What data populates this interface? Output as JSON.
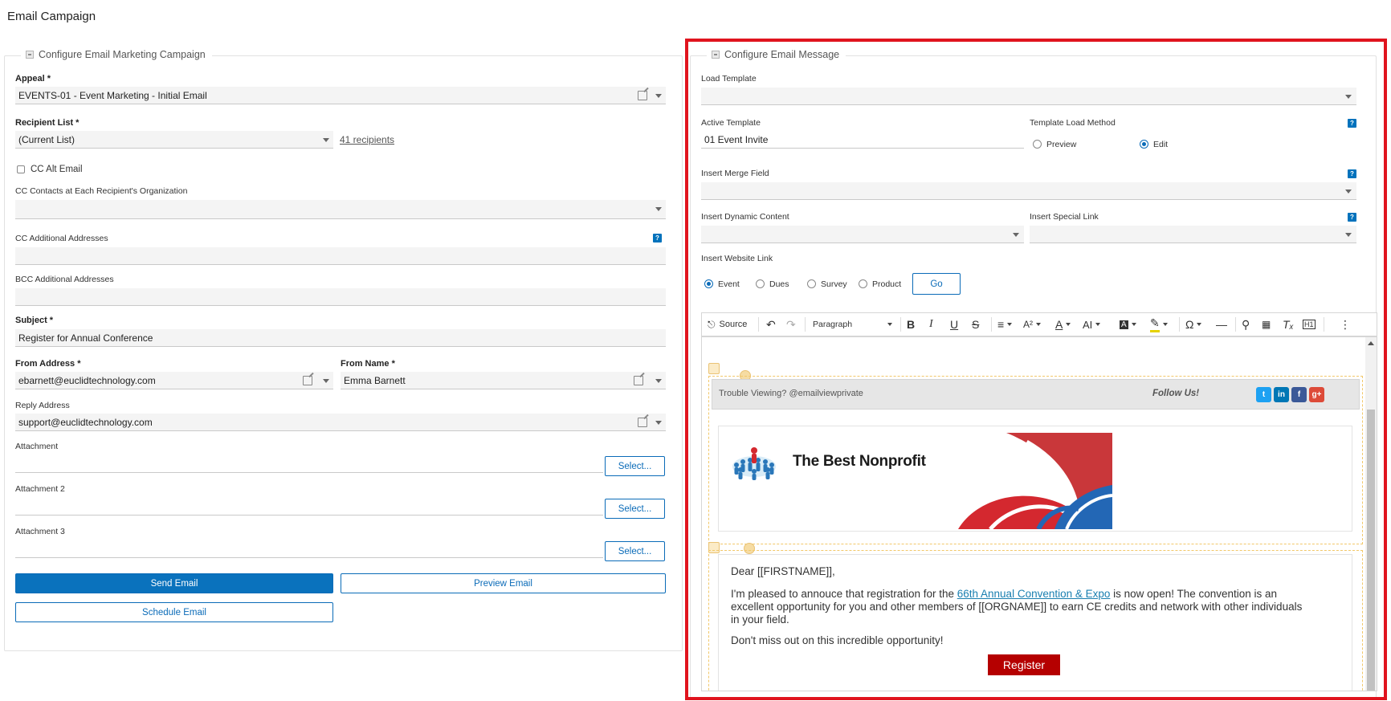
{
  "page_title": "Email Campaign",
  "left_panel": {
    "legend": "Configure Email Marketing Campaign",
    "appeal": {
      "label": "Appeal *",
      "value": "EVENTS-01 - Event Marketing - Initial Email"
    },
    "recipient_list": {
      "label": "Recipient List *",
      "value": "(Current List)",
      "link": "41 recipients"
    },
    "cc_alt_email": {
      "label": "CC Alt Email"
    },
    "cc_contacts": {
      "label": "CC Contacts at Each Recipient's Organization",
      "value": ""
    },
    "cc_additional": {
      "label": "CC Additional Addresses",
      "value": ""
    },
    "bcc_additional": {
      "label": "BCC Additional Addresses",
      "value": ""
    },
    "subject": {
      "label": "Subject *",
      "value": "Register for Annual Conference"
    },
    "from_address": {
      "label": "From Address *",
      "value": "ebarnett@euclidtechnology.com"
    },
    "from_name": {
      "label": "From Name *",
      "value": "Emma Barnett"
    },
    "reply_address": {
      "label": "Reply Address",
      "value": "support@euclidtechnology.com"
    },
    "attachments": [
      {
        "label": "Attachment",
        "button": "Select..."
      },
      {
        "label": "Attachment 2",
        "button": "Select..."
      },
      {
        "label": "Attachment 3",
        "button": "Select..."
      }
    ],
    "buttons": {
      "send": "Send Email",
      "preview": "Preview Email",
      "schedule": "Schedule Email"
    }
  },
  "right_panel": {
    "legend": "Configure Email Message",
    "load_template": {
      "label": "Load Template",
      "value": ""
    },
    "active_template": {
      "label": "Active Template",
      "value": "01 Event Invite"
    },
    "template_load_method": {
      "label": "Template Load Method",
      "options": [
        "Preview",
        "Edit"
      ],
      "selected": "Edit"
    },
    "insert_merge_field": {
      "label": "Insert Merge Field",
      "value": ""
    },
    "insert_dynamic_content": {
      "label": "Insert Dynamic Content",
      "value": ""
    },
    "insert_special_link": {
      "label": "Insert Special Link",
      "value": ""
    },
    "insert_website_link": {
      "label": "Insert Website Link",
      "options": [
        "Event",
        "Dues",
        "Survey",
        "Product"
      ],
      "selected": "Event",
      "go_button": "Go"
    },
    "help_glyph": "?"
  },
  "editor": {
    "toolbar": {
      "source": "Source",
      "paragraph": "Paragraph"
    },
    "email": {
      "trouble_viewing": "Trouble Viewing? @emailviewprivate",
      "follow_us": "Follow Us!",
      "social": [
        {
          "name": "twitter-icon",
          "glyph": "t",
          "color": "#1da1f2"
        },
        {
          "name": "linkedin-icon",
          "glyph": "in",
          "color": "#0077b5"
        },
        {
          "name": "facebook-icon",
          "glyph": "f",
          "color": "#3b5998"
        },
        {
          "name": "google-plus-icon",
          "glyph": "g+",
          "color": "#dd4b39"
        }
      ],
      "org_name": "The Best Nonprofit",
      "greeting": "Dear [[FIRSTNAME]],",
      "para1_before": "I'm pleased to annouce that registration for the ",
      "para1_link": "66th Annual Convention & Expo",
      "para1_after": " is now open! The convention is an excellent opportunity for you and other members of [[ORGNAME]] to earn CE credits and network with other individuals in your field.",
      "para2": "Don't miss out on this incredible opportunity!",
      "register_button": "Register"
    }
  },
  "colors": {
    "accent": "#0a72bd",
    "highlight": "#e0141e",
    "register": "#b50000"
  }
}
